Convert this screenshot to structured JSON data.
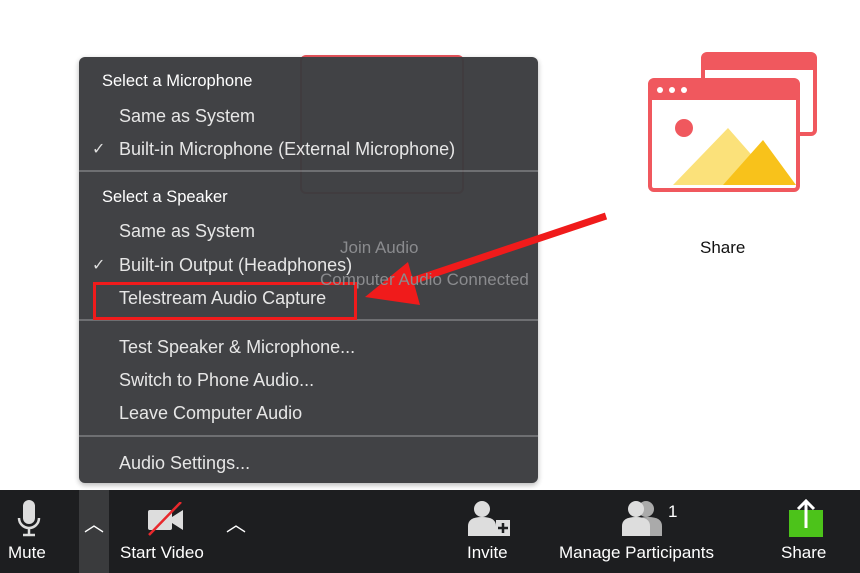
{
  "background": {
    "join_audio": "Join Audio",
    "join_audio_status": "Computer Audio Connected",
    "share_label": "Share"
  },
  "menu": {
    "mic_header": "Select a Microphone",
    "mic_items": [
      {
        "label": "Same as System",
        "checked": false
      },
      {
        "label": "Built-in Microphone (External Microphone)",
        "checked": true
      }
    ],
    "speaker_header": "Select a Speaker",
    "speaker_items": [
      {
        "label": "Same as System",
        "checked": false
      },
      {
        "label": "Built-in Output (Headphones)",
        "checked": true
      },
      {
        "label": "Telestream Audio Capture",
        "checked": false,
        "highlighted": true
      }
    ],
    "actions": [
      "Test Speaker & Microphone...",
      "Switch to Phone Audio...",
      "Leave Computer Audio"
    ],
    "settings": "Audio Settings...",
    "check_glyph": "✓"
  },
  "toolbar": {
    "mute": "Mute",
    "start_video": "Start Video",
    "invite": "Invite",
    "manage_participants": "Manage Participants",
    "participant_count": "1",
    "share": "Share"
  },
  "colors": {
    "annotation": "#f01b1b",
    "share_green": "#4cc31a",
    "menu_bg": "#3b3c3f",
    "toolbar_bg": "#1d1e20"
  }
}
